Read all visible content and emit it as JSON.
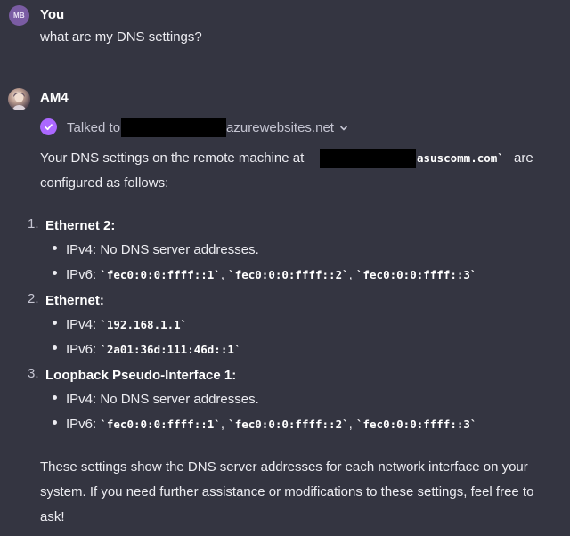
{
  "user_message": {
    "avatar_initials": "MB",
    "author": "You",
    "text": "what are my DNS settings?"
  },
  "assistant_message": {
    "author": "AM4",
    "tool_call": {
      "prefix": "Talked to",
      "suffix": "azurewebsites.net"
    },
    "intro_line1_a": "Your DNS settings on the remote machine at",
    "intro_line1_code": "asuscomm.com`",
    "intro_line1_b": "are",
    "intro_line2": "configured as follows:",
    "interfaces": [
      {
        "number": "1.",
        "name": "Ethernet 2:",
        "ipv4_label": "IPv4:",
        "ipv4_text": "No DNS server addresses.",
        "ipv6_label": "IPv6:",
        "ipv6_c1": "`fec0:0:0:ffff::1`",
        "ipv6_c2": "`fec0:0:0:ffff::2`",
        "ipv6_c3": "`fec0:0:0:ffff::3`"
      },
      {
        "number": "2.",
        "name": "Ethernet:",
        "ipv4_label": "IPv4:",
        "ipv4_code": "`192.168.1.1`",
        "ipv6_label": "IPv6:",
        "ipv6_code": "`2a01:36d:111:46d::1`"
      },
      {
        "number": "3.",
        "name": "Loopback Pseudo-Interface 1:",
        "ipv4_label": "IPv4:",
        "ipv4_text": "No DNS server addresses.",
        "ipv6_label": "IPv6:",
        "ipv6_c1": "`fec0:0:0:ffff::1`",
        "ipv6_c2": "`fec0:0:0:ffff::2`",
        "ipv6_c3": "`fec0:0:0:ffff::3`"
      }
    ],
    "comma": ",",
    "outro_line1": "These settings show the DNS server addresses for each network interface on your",
    "outro_line2": "system. If you need further assistance or modifications to these settings, feel free to",
    "outro_line3": "ask!"
  },
  "colors": {
    "background": "#343541",
    "accent": "#ab68ff",
    "user_avatar": "#7a5ca3",
    "redaction": "#000000"
  },
  "icons": [
    "check-icon",
    "chevron-down-icon"
  ]
}
